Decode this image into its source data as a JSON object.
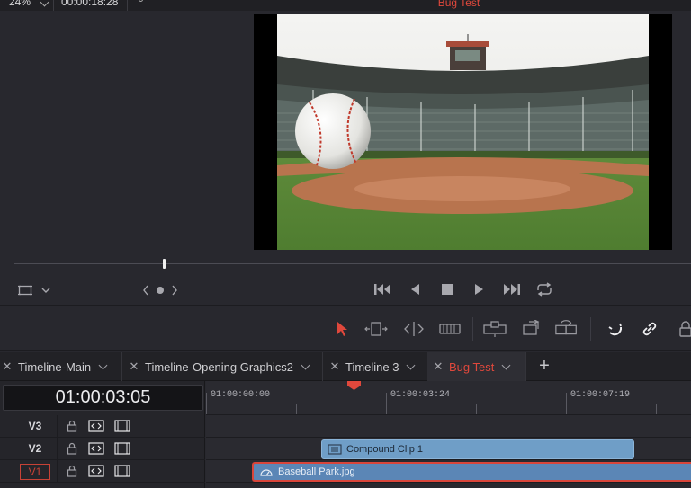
{
  "viewer": {
    "zoom": "24%",
    "source_timecode": "00:00:18:28",
    "title": "Bug Test"
  },
  "tabs": [
    {
      "label": "Timeline-Main",
      "active": false
    },
    {
      "label": "Timeline-Opening Graphics2",
      "active": false
    },
    {
      "label": "Timeline 3",
      "active": false
    },
    {
      "label": "Bug Test",
      "active": true
    }
  ],
  "timeline": {
    "timecode": "01:00:03:05",
    "ruler_labels": [
      "01:00:00:00",
      "01:00:03:24",
      "01:00:07:19"
    ],
    "tracks": [
      {
        "name": "V3",
        "highlighted": false
      },
      {
        "name": "V2",
        "highlighted": false
      },
      {
        "name": "V1",
        "highlighted": true
      }
    ],
    "clips": {
      "compound": "Compound Clip 1",
      "baseball": "Baseball Park.jpg"
    }
  },
  "colors": {
    "accent": "#e0483c",
    "clip_compound": "#6f9ec7",
    "clip_image": "#5b86b6",
    "background": "#28282e"
  },
  "icons": {
    "transport": [
      "jump-to-start-icon",
      "play-reverse-icon",
      "stop-icon",
      "play-icon",
      "jump-to-end-icon",
      "loop-icon"
    ],
    "tools": [
      "selection-tool-icon",
      "trim-edit-icon",
      "dynamic-trim-icon",
      "blade-tool-icon",
      "insert-clip-icon",
      "overwrite-clip-icon",
      "replace-clip-icon",
      "snapping-icon",
      "linked-selection-icon",
      "position-lock-icon"
    ]
  }
}
